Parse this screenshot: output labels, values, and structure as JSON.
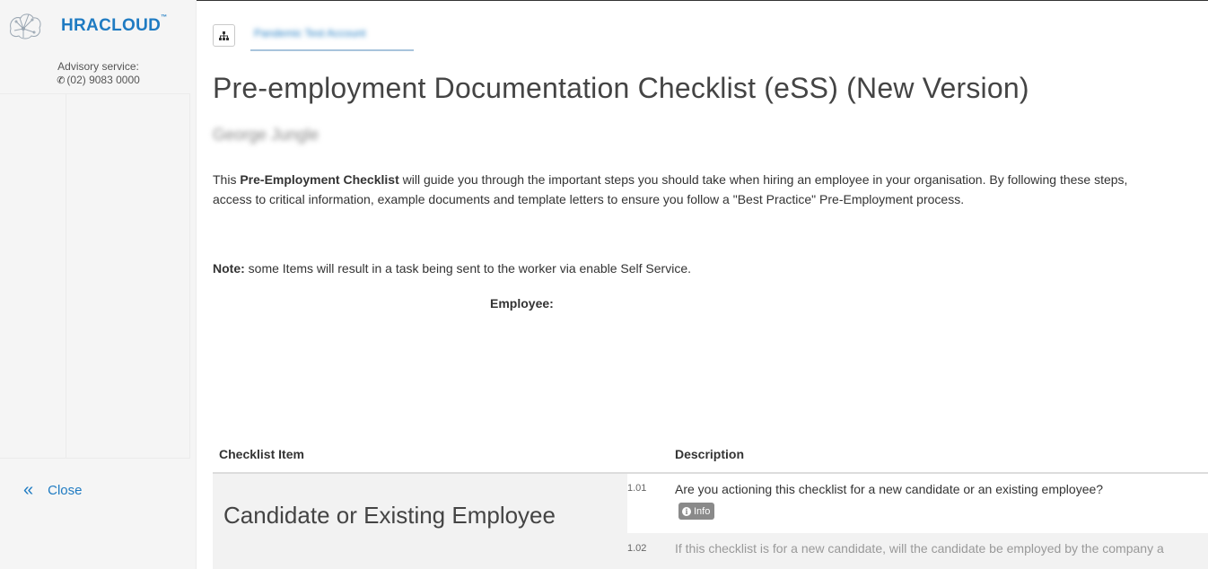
{
  "sidebar": {
    "brand": "HRACLOUD",
    "advisory_label": "Advisory service:",
    "phone": "(02) 9083 0000",
    "close_label": "Close"
  },
  "header": {
    "breadcrumb": "Pandemic Test Account",
    "title": "Pre-employment Documentation Checklist (eSS) (New Version)",
    "employee_name": "George Jungle"
  },
  "intro": {
    "line1_pre": "This ",
    "line1_bold": "Pre-Employment Checklist",
    "line1_post": " will guide you through the important steps you should take when hiring an employee in your organisation. By following these steps,",
    "line2": "access to critical information, example documents and template letters to ensure you follow a \"Best Practice\" Pre-Employment process.",
    "note_bold": "Note:",
    "note_text": " some Items will result in a task being sent to the worker via enable Self Service.",
    "employee_label": "Employee:"
  },
  "table": {
    "col_item": "Checklist Item",
    "col_description": "Description",
    "group_title": "Candidate or Existing Employee",
    "rows": [
      {
        "num": "1.01",
        "text": "Are you actioning this checklist for a new candidate or an existing employee?",
        "badge": "Info"
      },
      {
        "num": "1.02",
        "text": "If this checklist is for a new candidate, will the candidate be employed by the company a"
      }
    ]
  },
  "colors": {
    "accent": "#1f7bc2",
    "badge": "#8a8a8a"
  },
  "icons": {
    "logo": "hra-cloud-logo-icon",
    "phone": "phone-icon",
    "close": "double-chevron-left-icon",
    "tree": "sitemap-icon",
    "info": "info-circle-icon"
  }
}
